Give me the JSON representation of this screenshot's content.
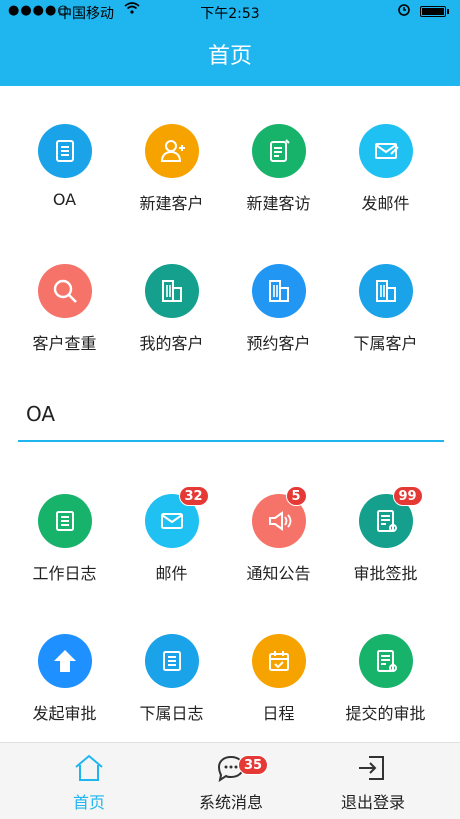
{
  "status_bar": {
    "signal": "●●●●○",
    "carrier": "中国移动",
    "time": "下午2:53"
  },
  "header": {
    "title": "首页"
  },
  "top_grid": [
    {
      "label": "OA",
      "icon": "document-icon",
      "color": "#1aa3e8"
    },
    {
      "label": "新建客户",
      "icon": "add-user-icon",
      "color": "#f6a300"
    },
    {
      "label": "新建客访",
      "icon": "note-edit-icon",
      "color": "#18b36b"
    },
    {
      "label": "发邮件",
      "icon": "mail-send-icon",
      "color": "#1fc0f2"
    },
    {
      "label": "客户查重",
      "icon": "search-icon",
      "color": "#f6736a"
    },
    {
      "label": "我的客户",
      "icon": "building-icon",
      "color": "#14a08c"
    },
    {
      "label": "预约客户",
      "icon": "building-icon",
      "color": "#2196f3"
    },
    {
      "label": "下属客户",
      "icon": "building-icon",
      "color": "#1aa3e8"
    }
  ],
  "section": {
    "title": "OA"
  },
  "oa_grid": [
    {
      "label": "工作日志",
      "icon": "list-icon",
      "color": "#18b36b",
      "badge": ""
    },
    {
      "label": "邮件",
      "icon": "mail-icon",
      "color": "#1fc0f2",
      "badge": "32"
    },
    {
      "label": "通知公告",
      "icon": "speaker-icon",
      "color": "#f6736a",
      "badge": "5"
    },
    {
      "label": "审批签批",
      "icon": "approve-icon",
      "color": "#14a08c",
      "badge": "99"
    },
    {
      "label": "发起审批",
      "icon": "upload-icon",
      "color": "#1e90ff",
      "badge": ""
    },
    {
      "label": "下属日志",
      "icon": "list-icon",
      "color": "#1aa3e8",
      "badge": ""
    },
    {
      "label": "日程",
      "icon": "calendar-icon",
      "color": "#f6a300",
      "badge": ""
    },
    {
      "label": "提交的审批",
      "icon": "approve-icon",
      "color": "#18b36b",
      "badge": ""
    }
  ],
  "tab_bar": {
    "home": "首页",
    "messages": "系统消息",
    "messages_badge": "35",
    "logout": "退出登录",
    "active_color": "#1fb6ef"
  }
}
